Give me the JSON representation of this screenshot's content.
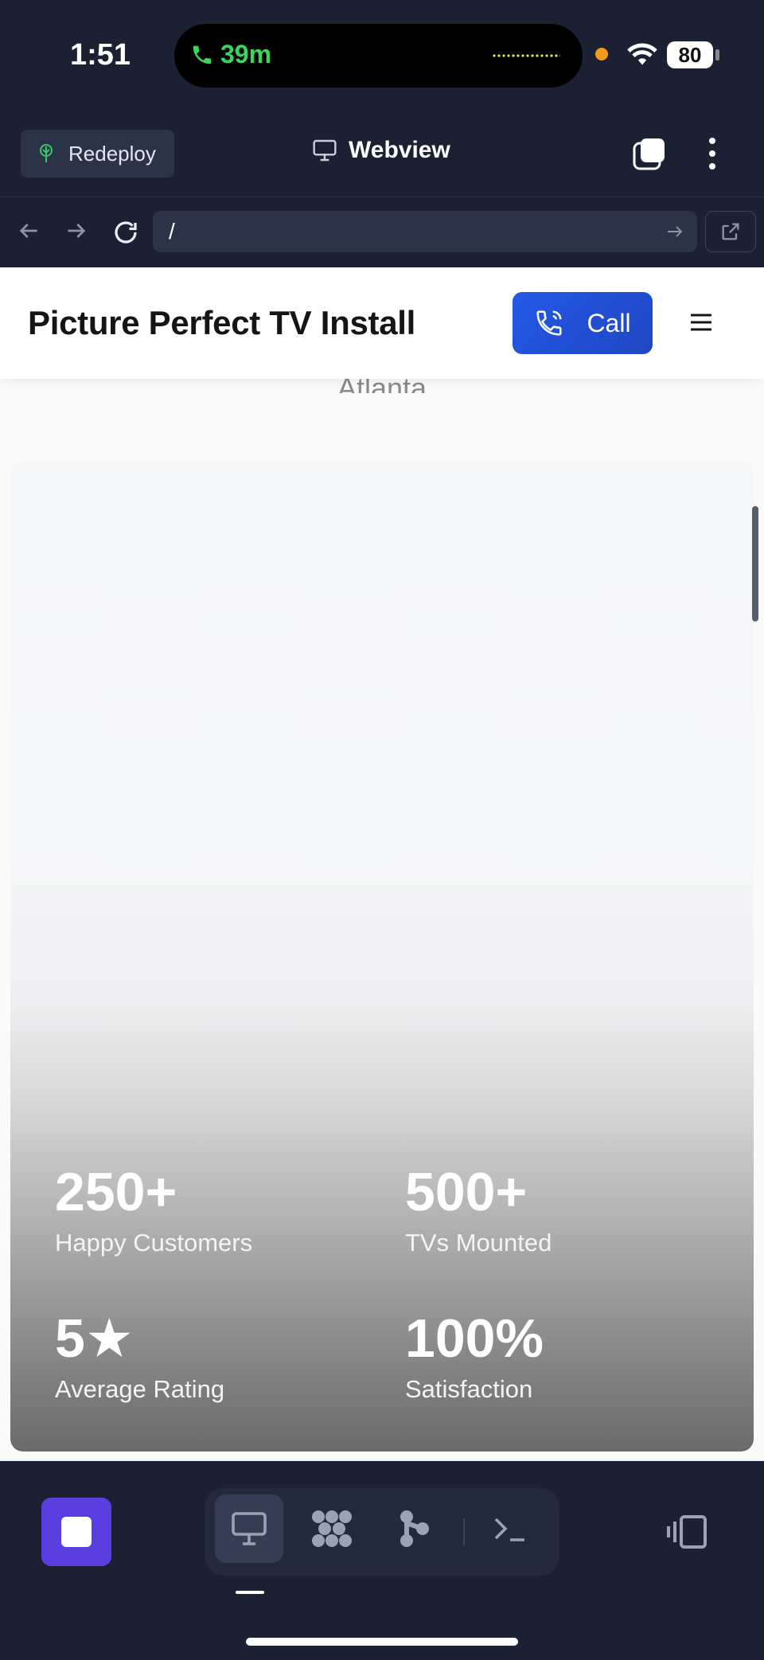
{
  "status_bar": {
    "time": "1:51",
    "call_duration": "39m",
    "battery": "80"
  },
  "app_toolbar": {
    "redeploy_label": "Redeploy",
    "title": "Webview"
  },
  "url_bar": {
    "value": "/"
  },
  "site": {
    "title": "Picture Perfect TV Install",
    "call_label": "Call",
    "city": "Atlanta",
    "stats": [
      {
        "value": "250+",
        "label": "Happy Customers"
      },
      {
        "value": "500+",
        "label": "TVs Mounted"
      },
      {
        "value": "5★",
        "label": "Average Rating"
      },
      {
        "value": "100%",
        "label": "Satisfaction"
      }
    ]
  },
  "colors": {
    "accent": "#2459e6",
    "dock_stop": "#5b3ee0",
    "chrome_bg": "#1b2132"
  },
  "icons": {
    "redeploy": "sprout-icon",
    "webview": "monitor-icon",
    "dock": [
      "monitor-icon",
      "puzzle-icon",
      "share-icon",
      "terminal-icon"
    ]
  }
}
